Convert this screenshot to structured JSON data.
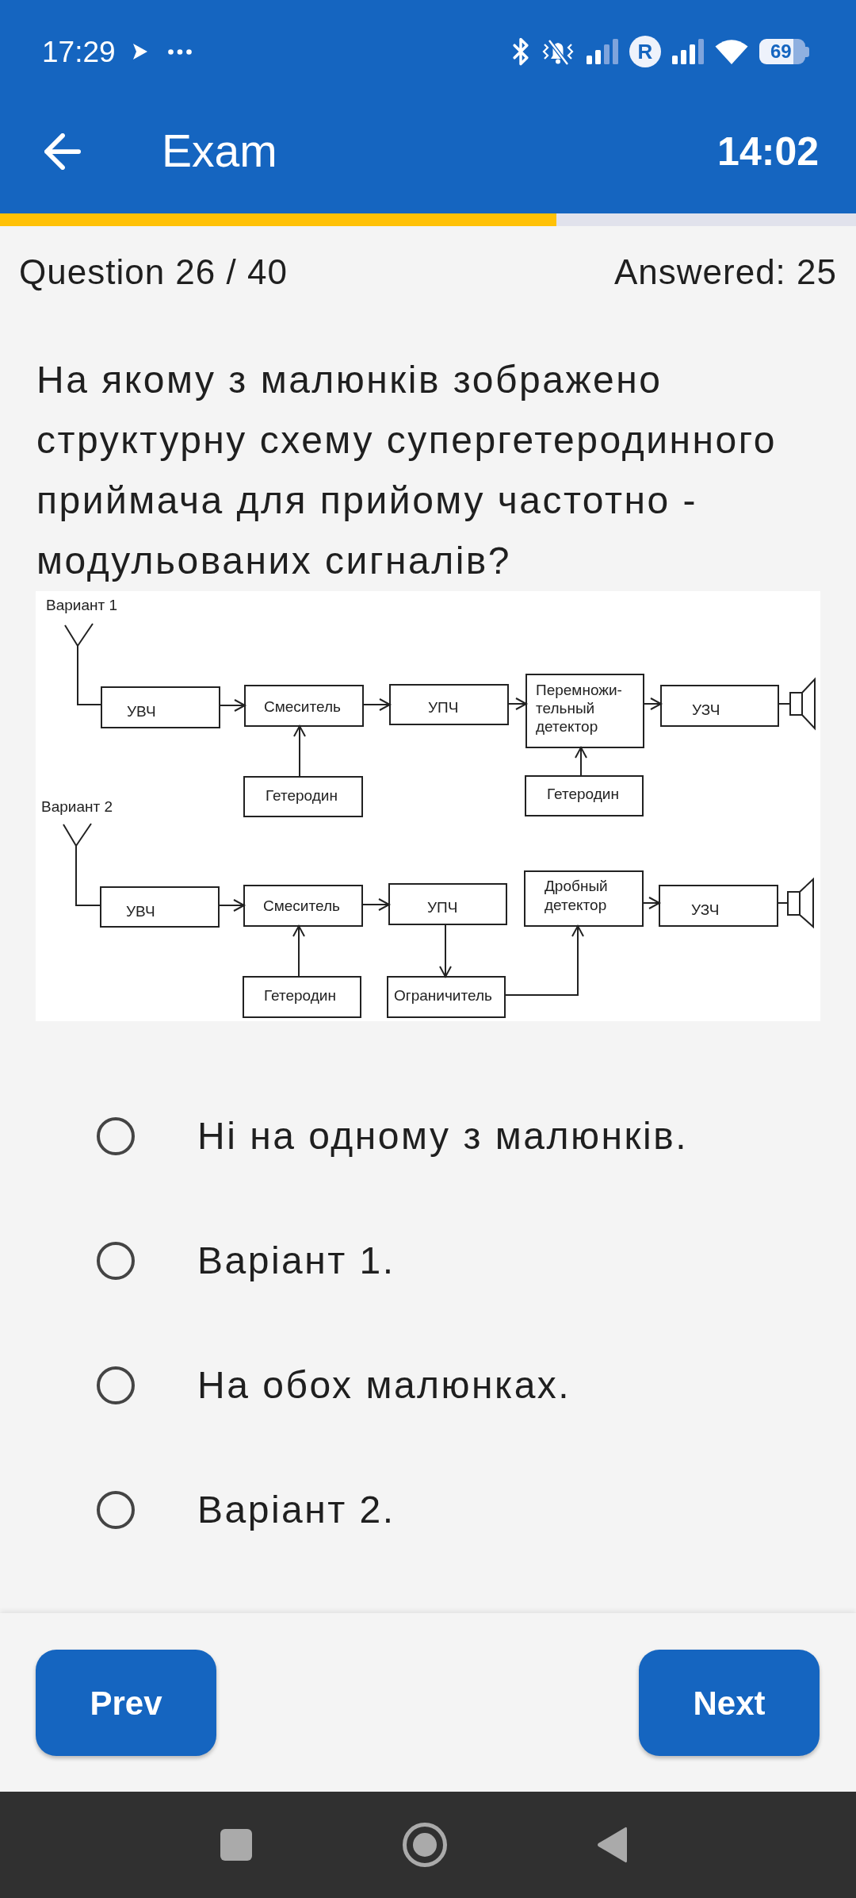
{
  "status_bar": {
    "time": "17:29",
    "roaming": "R",
    "battery": "69"
  },
  "app_bar": {
    "title": "Exam",
    "timer": "14:02"
  },
  "progress": {
    "level": 0.65
  },
  "counter": {
    "question": "Question 26 / 40",
    "answered": "Answered: 25"
  },
  "question": {
    "text": "На якому з малюнків зображено структурну схему супергетеродинного приймача для прийому частотно - модульованих сигналів?"
  },
  "diagram": {
    "variants": [
      {
        "label": "Вариант 1",
        "blocks": [
          {
            "lines": [
              "УВЧ"
            ]
          },
          {
            "lines": [
              "Смеситель"
            ]
          },
          {
            "lines": [
              "УПЧ"
            ]
          },
          {
            "lines": [
              "Перемножи-",
              "тельный",
              "детектор"
            ]
          },
          {
            "lines": [
              "УЗЧ"
            ]
          },
          {
            "lines": [
              "Гетеродин"
            ]
          },
          {
            "lines": [
              "Гетеродин"
            ]
          }
        ]
      },
      {
        "label": "Вариант 2",
        "blocks": [
          {
            "lines": [
              "УВЧ"
            ]
          },
          {
            "lines": [
              "Смеситель"
            ]
          },
          {
            "lines": [
              "УПЧ"
            ]
          },
          {
            "lines": [
              "Дробный",
              "детектор"
            ]
          },
          {
            "lines": [
              "УЗЧ"
            ]
          },
          {
            "lines": [
              "Гетеродин"
            ]
          },
          {
            "lines": [
              "Ограничитель"
            ]
          }
        ]
      }
    ]
  },
  "options": [
    {
      "text": "Ні на одному з малюнків.",
      "selected": false
    },
    {
      "text": "Варіант 1.",
      "selected": false
    },
    {
      "text": "На обох малюнках.",
      "selected": false
    },
    {
      "text": "Варіант 2.",
      "selected": false
    }
  ],
  "buttons": [
    {
      "label": "Prev"
    },
    {
      "label": "Next"
    }
  ]
}
